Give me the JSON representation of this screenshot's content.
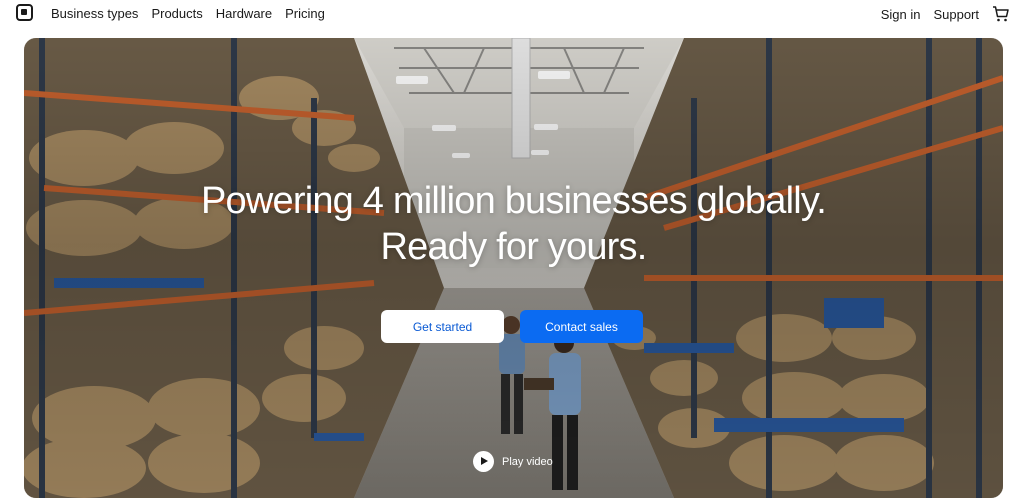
{
  "nav": {
    "links": [
      "Business types",
      "Products",
      "Hardware",
      "Pricing"
    ],
    "sign_in": "Sign in",
    "support": "Support"
  },
  "hero": {
    "headline_line1": "Powering 4 million businesses globally.",
    "headline_line2": "Ready for yours.",
    "get_started": "Get started",
    "contact_sales": "Contact sales",
    "play_video": "Play video"
  },
  "colors": {
    "accent": "#0b6bf2",
    "text": "#1a1a1a"
  },
  "icons": [
    "square-logo-icon",
    "cart-icon",
    "play-icon"
  ]
}
